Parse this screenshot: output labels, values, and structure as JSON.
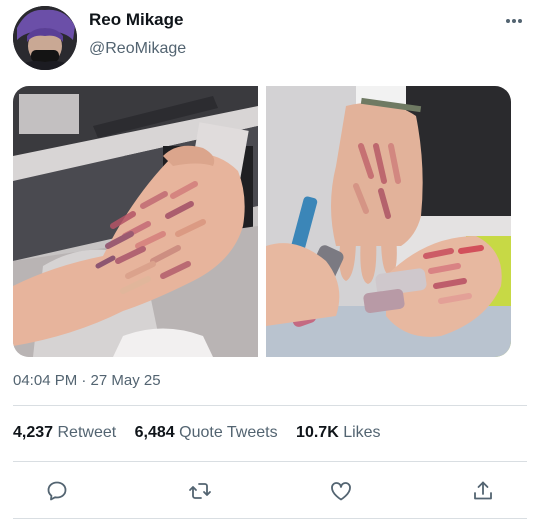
{
  "tweet": {
    "author": {
      "display_name": "Reo Mikage",
      "handle": "@ReoMikage"
    },
    "timestamp": "04:04 PM · 27 May 25",
    "stats": {
      "retweets_count": "4,237",
      "retweets_label": "Retweet",
      "quote_count": "6,484",
      "quote_label": "Quote Tweets",
      "likes_count": "10.7K",
      "likes_label": "Likes"
    },
    "media": [
      {
        "description_icon": "photo-hand-swatches"
      },
      {
        "description_icon": "photo-hand-swatches-lipsticks"
      }
    ]
  },
  "icons": {
    "more": "more-horizontal-icon",
    "reply": "reply-icon",
    "retweet": "retweet-icon",
    "like": "heart-icon",
    "share": "share-icon"
  },
  "colors": {
    "text_primary": "#0f1419",
    "text_secondary": "#536471",
    "divider": "#d9dee2"
  }
}
